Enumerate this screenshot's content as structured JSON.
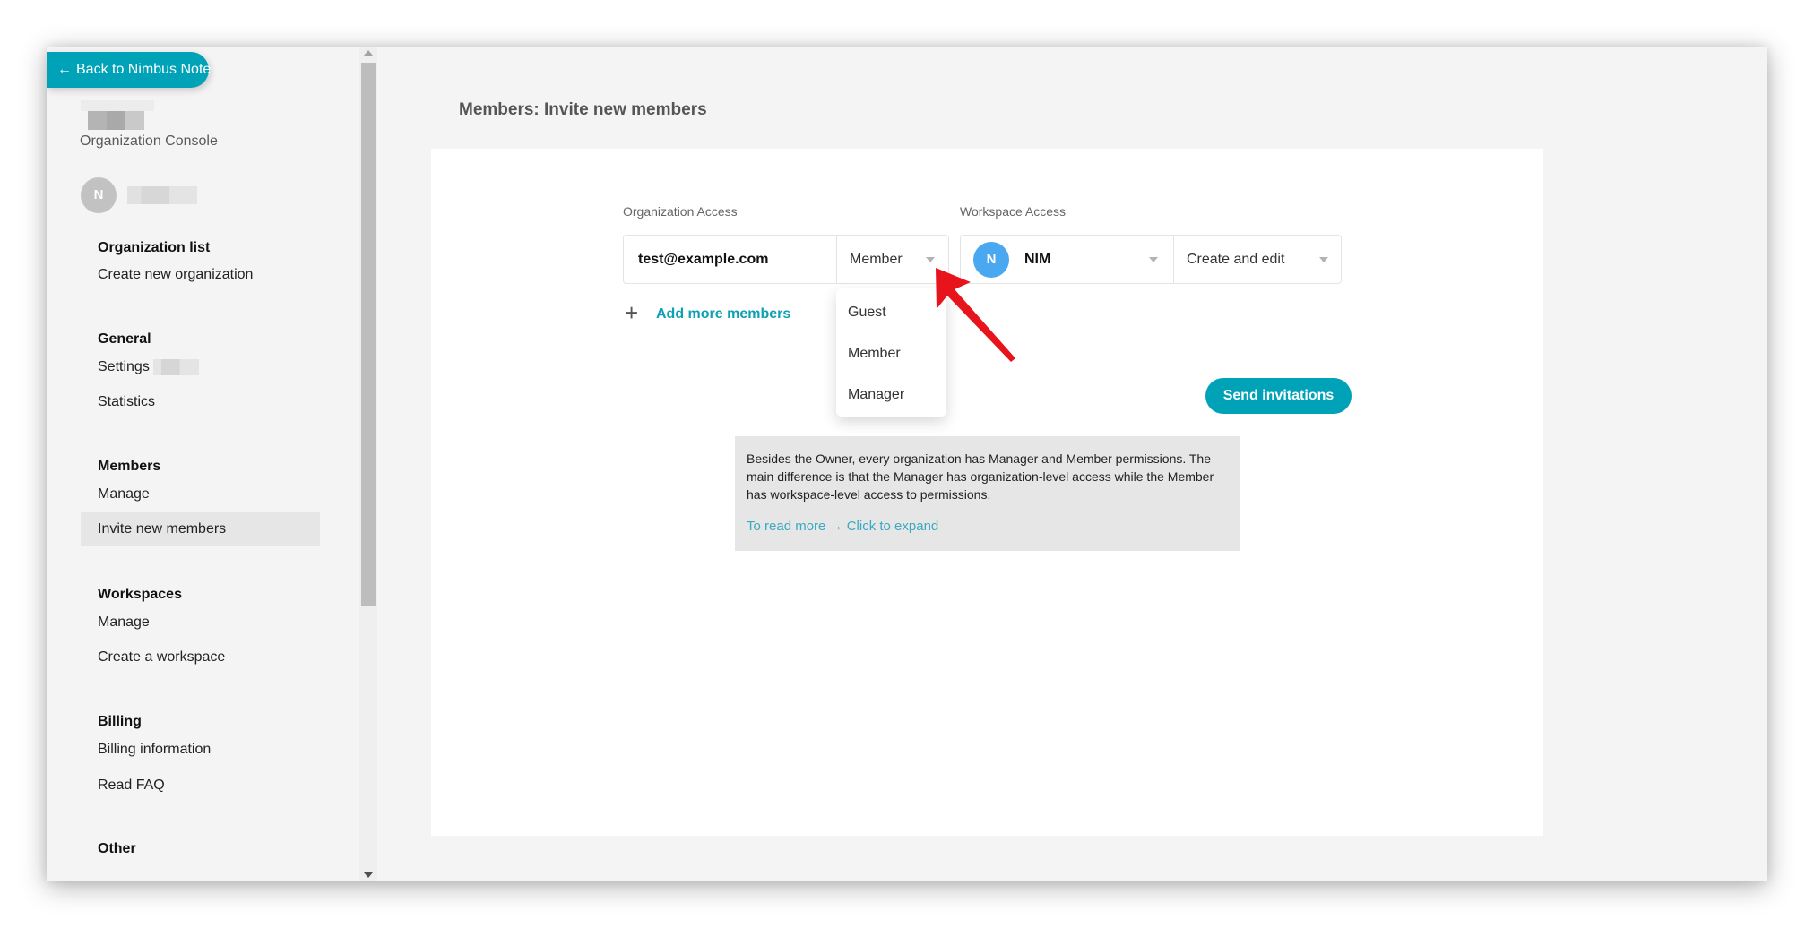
{
  "sidebar": {
    "back_button": "Back to Nimbus Note",
    "back_arrow": "←",
    "console_label": "Organization Console",
    "user_avatar_initial": "N",
    "sections": [
      {
        "heading": "Organization list",
        "items": [
          {
            "label": "Create new organization"
          }
        ]
      },
      {
        "heading": "General",
        "items": [
          {
            "label": "Settings"
          },
          {
            "label": "Statistics"
          }
        ]
      },
      {
        "heading": "Members",
        "items": [
          {
            "label": "Manage"
          },
          {
            "label": "Invite new members",
            "active": true
          }
        ]
      },
      {
        "heading": "Workspaces",
        "items": [
          {
            "label": "Manage"
          },
          {
            "label": "Create a workspace"
          }
        ]
      },
      {
        "heading": "Billing",
        "items": [
          {
            "label": "Billing information"
          },
          {
            "label": "Read FAQ"
          }
        ]
      },
      {
        "heading": "Other",
        "items": []
      }
    ]
  },
  "main": {
    "page_title": "Members: Invite new members",
    "org_access_label": "Organization Access",
    "workspace_access_label": "Workspace Access",
    "email_value": "test@example.com",
    "role_select": {
      "value": "Member",
      "options": [
        "Guest",
        "Member",
        "Manager"
      ]
    },
    "workspace_select": {
      "avatar_initial": "N",
      "value": "NIM"
    },
    "permission_select": {
      "value": "Create and edit"
    },
    "add_more_icon": "+",
    "add_more_label": "Add more members",
    "send_button": "Send invitations",
    "info": {
      "text": "Besides the Owner, every organization has Manager and Member permissions. The main difference is that the Manager has organization-level access while the Member has workspace-level access to permissions.",
      "link": "To read more → Click to expand"
    }
  },
  "colors": {
    "accent": "#00a2b8",
    "workspace_avatar": "#4aa8f0",
    "annotation_arrow": "#e8141b"
  }
}
